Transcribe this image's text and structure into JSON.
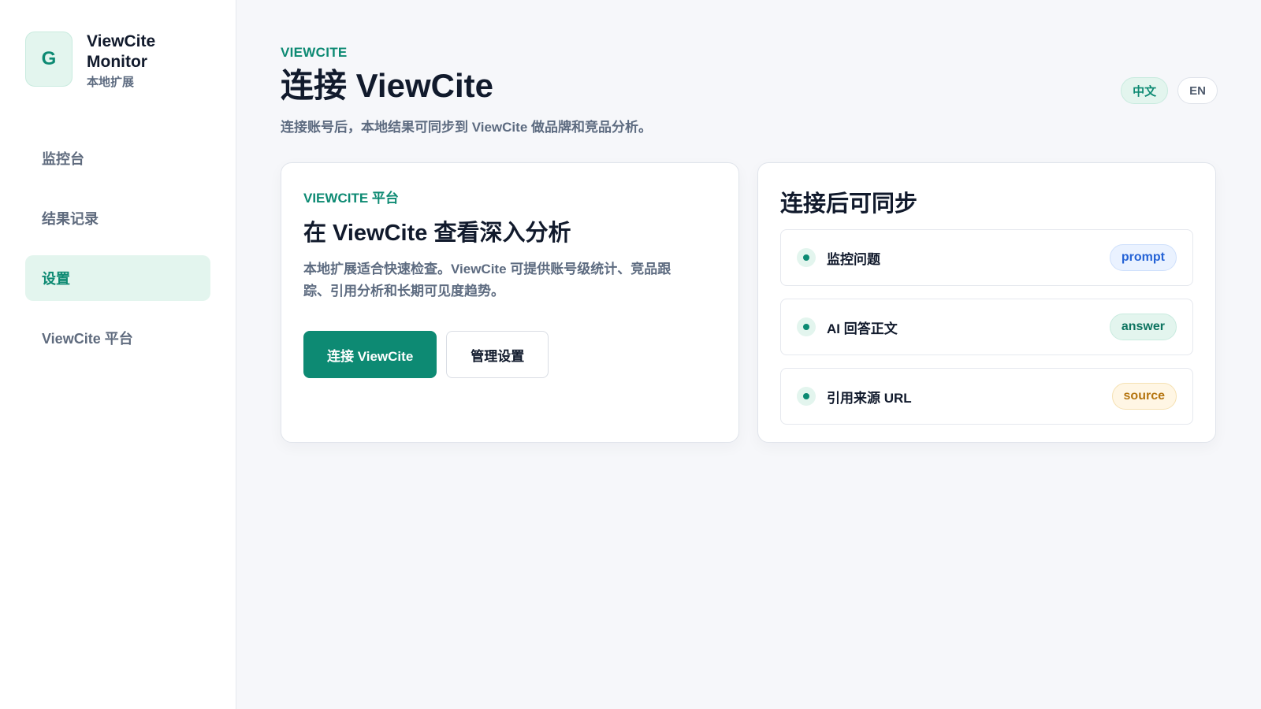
{
  "sidebar": {
    "logo_letter": "G",
    "brand_name": "ViewCite Monitor",
    "brand_sub": "本地扩展",
    "items": [
      {
        "label": "监控台"
      },
      {
        "label": "结果记录"
      },
      {
        "label": "设置"
      },
      {
        "label": "ViewCite 平台"
      }
    ],
    "active_index": 2
  },
  "header": {
    "eyebrow": "VIEWCITE",
    "title": "连接 ViewCite",
    "subtitle": "连接账号后，本地结果可同步到 ViewCite 做品牌和竞品分析。",
    "lang": {
      "zh": "中文",
      "en": "EN",
      "active": "zh"
    }
  },
  "platform_card": {
    "eyebrow": "VIEWCITE 平台",
    "title": "在 ViewCite 查看深入分析",
    "description": "本地扩展适合快速检查。ViewCite 可提供账号级统计、竞品跟踪、引用分析和长期可见度趋势。",
    "connect_label": "连接 ViewCite",
    "manage_label": "管理设置"
  },
  "sync_card": {
    "title": "连接后可同步",
    "items": [
      {
        "label": "监控问题",
        "tag": "prompt"
      },
      {
        "label": "AI 回答正文",
        "tag": "answer"
      },
      {
        "label": "引用来源 URL",
        "tag": "source"
      }
    ]
  },
  "colors": {
    "accent": "#0d8a73",
    "accent_soft": "#e3f5ee",
    "tag_blue": "#2563d6",
    "tag_amber": "#b57510"
  }
}
